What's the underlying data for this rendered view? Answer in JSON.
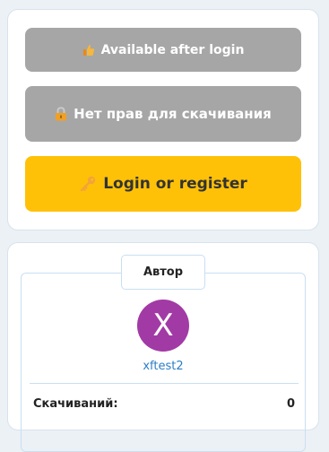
{
  "actions": {
    "available": {
      "icon": "thumbs-up-icon",
      "label": "Available after login"
    },
    "no_rights": {
      "icon": "lock-icon",
      "label": "Нет прав для скачивания"
    },
    "login": {
      "icon": "key-icon",
      "label": "Login or register"
    }
  },
  "author": {
    "title": "Автор",
    "avatar_letter": "X",
    "avatar_color": "#a23aa5",
    "username": "xftest2",
    "downloads_label": "Скачиваний:",
    "downloads_value": "0"
  },
  "colors": {
    "disabled_button": "#a6a6a6",
    "login_button": "#ffc107",
    "link": "#2d7ec6"
  }
}
